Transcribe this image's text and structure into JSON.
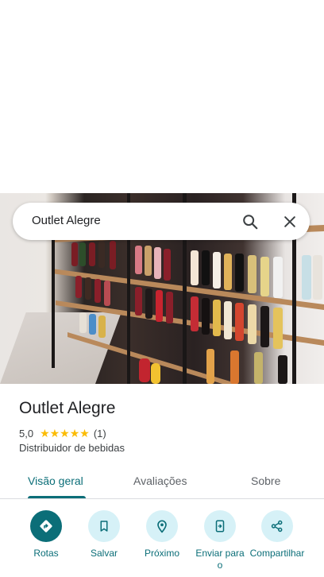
{
  "search": {
    "query": "Outlet Alegre"
  },
  "place": {
    "name": "Outlet Alegre",
    "rating": "5,0",
    "stars": "★★★★★",
    "review_count": "(1)",
    "category": "Distribuidor de bebidas"
  },
  "tabs": [
    {
      "label": "Visão geral",
      "active": true
    },
    {
      "label": "Avaliações",
      "active": false
    },
    {
      "label": "Sobre",
      "active": false
    }
  ],
  "actions": [
    {
      "label": "Rotas",
      "icon": "directions-icon"
    },
    {
      "label": "Salvar",
      "icon": "bookmark-icon"
    },
    {
      "label": "Próximo",
      "icon": "nearby-icon"
    },
    {
      "label": "Enviar para o",
      "icon": "send-to-phone-icon"
    },
    {
      "label": "Compartilhar",
      "icon": "share-icon"
    }
  ],
  "colors": {
    "accent": "#0b6e78",
    "accent_light": "#d6f1f7",
    "star": "#fbbc04"
  }
}
